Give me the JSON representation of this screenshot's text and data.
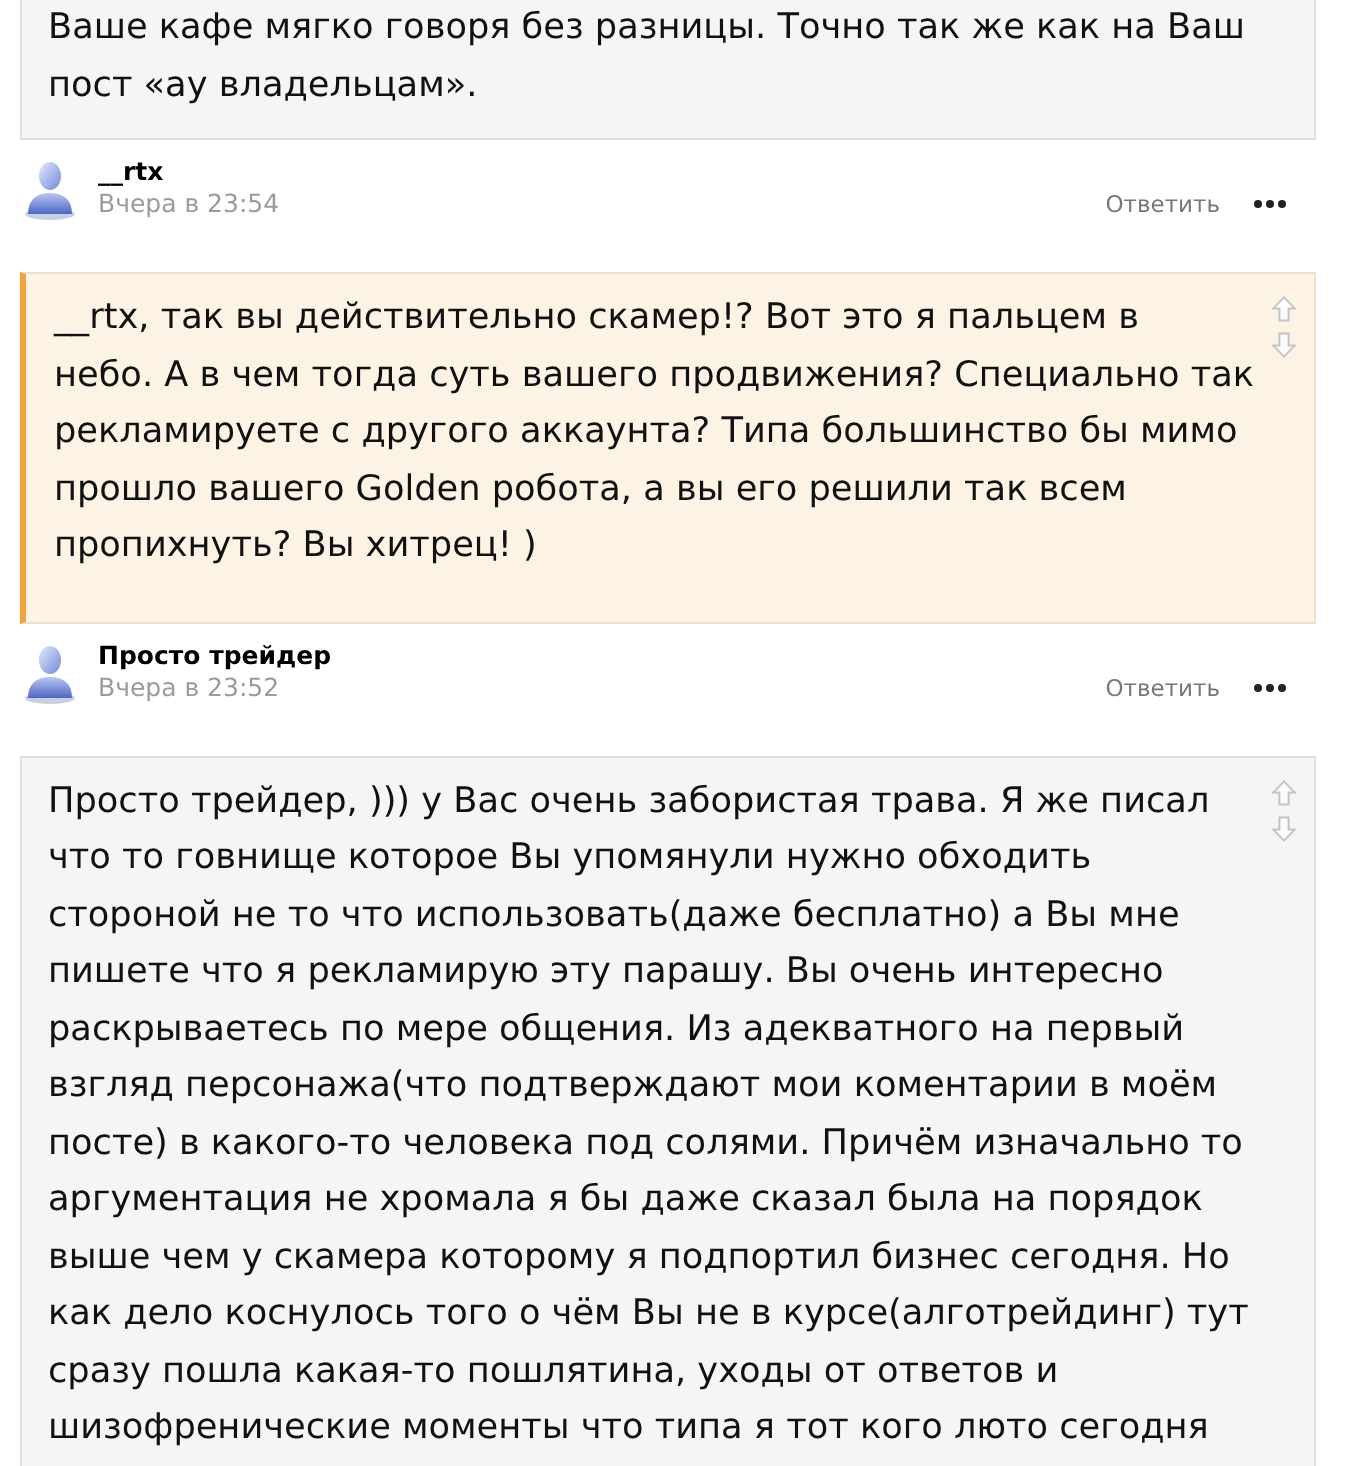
{
  "thread": [
    {
      "kind": "comment",
      "highlighted": false,
      "vote_arrows": false,
      "lines": [
        "Ваше кафе мягко говоря без разницы. Точно так же как на Ваш",
        "пост «ау владельцам»."
      ]
    },
    {
      "kind": "author",
      "name": "__rtx",
      "time": "Вчера в 23:54",
      "reply": "Ответить"
    },
    {
      "kind": "comment",
      "highlighted": true,
      "vote_arrows": true,
      "lines": [
        "__rtx, так вы действительно скамер!? Вот это я пальцем в",
        "небо. А в чем тогда суть вашего продвижения? Специально так",
        "рекламируете с другого аккаунта? Типа большинство бы мимо",
        "прошло вашего Golden робота, а вы его решили так всем",
        "пропихнуть? Вы хитрец! )"
      ]
    },
    {
      "kind": "author",
      "name": "Просто трейдер",
      "time": "Вчера в 23:52",
      "reply": "Ответить"
    },
    {
      "kind": "comment",
      "highlighted": false,
      "vote_arrows": true,
      "lines": [
        "Просто трейдер, ))) у Вас очень забористая трава. Я же писал",
        "что то говнище которое Вы упомянули нужно обходить",
        "стороной не то что использовать(даже бесплатно) а Вы мне",
        "пишете что я рекламирую эту парашу. Вы очень интересно",
        "раскрываетесь по мере общения. Из адекватного на первый",
        "взгляд персонажа(что подтверждают мои коментарии в моём",
        "посте) в какого-то человека под солями. Причём изначально то",
        "аргументация не хромала я бы даже сказал была на порядок",
        "выше чем у скамера которому я подпортил бизнес сегодня. Но",
        "как дело коснулось того о чём Вы не в курсе(алготрейдинг) тут",
        "сразу пошла какая-то пошлятина, уходы от ответов и",
        "шизофренические моменты что типа я тот кого люто сегодня"
      ]
    }
  ]
}
